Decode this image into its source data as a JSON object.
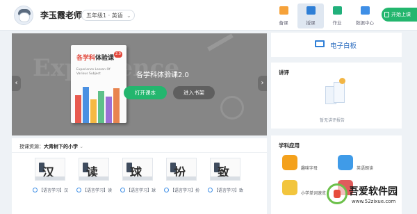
{
  "header": {
    "teacher_name": "李玉霞老师",
    "grade_select": "五年级1 · 英语",
    "nav": [
      {
        "label": "备课",
        "icon": "folder-icon"
      },
      {
        "label": "授课",
        "icon": "monitor-icon"
      },
      {
        "label": "作业",
        "icon": "book-icon"
      },
      {
        "label": "数据中心",
        "icon": "chart-icon"
      }
    ],
    "start_class": "开始上课"
  },
  "banner": {
    "ghost_text": "Experience",
    "book_cover_title_a": "各学科",
    "book_cover_title_b": "体验课",
    "book_cover_badge": "2.0",
    "book_cover_sub": "Experience Lesson Of Various Subject",
    "book_title": "各学科体验课2.0",
    "open_button": "打开课本",
    "shelf_button": "进入书架",
    "colors": {
      "open": "#23b66e",
      "overlay": "#868686"
    }
  },
  "resources": {
    "label": "授课资源：",
    "source": "大青树下的小学",
    "cards": [
      {
        "char": "汉",
        "caption": "【语言学习】汉"
      },
      {
        "char": "读",
        "caption": "【语言学习】读"
      },
      {
        "char": "球",
        "caption": "【语言学习】球"
      },
      {
        "char": "扮",
        "caption": "【语言学习】扮"
      },
      {
        "char": "致",
        "caption": "【语言学习】致"
      }
    ]
  },
  "whiteboard": {
    "label": "电子白板"
  },
  "lecture": {
    "title": "讲评",
    "empty_text": "暂无讲评报告"
  },
  "apps": {
    "title": "学科应用",
    "items": [
      {
        "label": "趣味字母",
        "icon": "abc-app-icon",
        "color": "#f4a11c"
      },
      {
        "label": "英语朗读",
        "icon": "read-app-icon",
        "color": "#3f9be8"
      },
      {
        "label": "小学单词速览",
        "icon": "word-app-icon",
        "color": "#f2c53d"
      },
      {
        "label": "",
        "icon": "app-icon",
        "color": "#e05c5c"
      }
    ]
  },
  "watermark": {
    "name": "吾爱软件园",
    "url": "www.52zixue.com"
  }
}
